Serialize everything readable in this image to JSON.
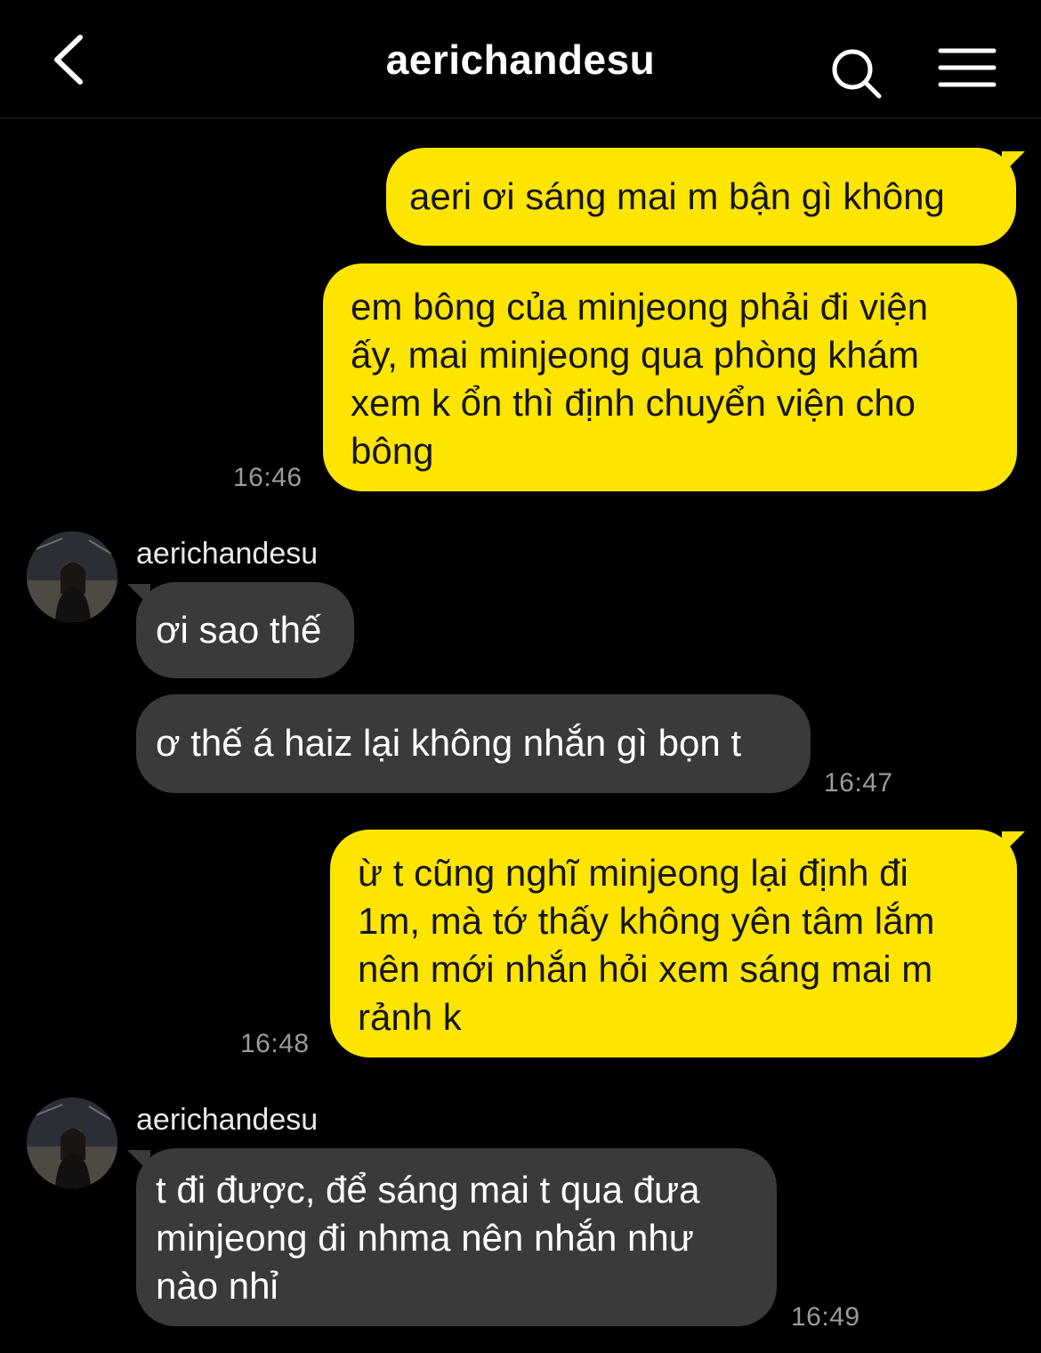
{
  "header": {
    "title": "aerichandesu",
    "back_icon": "chevron-left-icon",
    "search_icon": "search-icon",
    "menu_icon": "hamburger-menu-icon"
  },
  "colors": {
    "outgoing_bubble": "#FEE500",
    "incoming_bubble": "#3a3a3c",
    "background": "#000000",
    "timestamp": "#9a9a9a"
  },
  "messages": [
    {
      "direction": "out",
      "text": "aeri ơi sáng mai m bận gì không"
    },
    {
      "direction": "out",
      "lines": [
        "em bông của minjeong phải đi viện",
        "ấy, mai minjeong qua phòng khám",
        "xem k ổn thì định chuyển viện cho",
        "bông"
      ],
      "time": "16:46"
    },
    {
      "direction": "in",
      "sender": "aerichandesu",
      "text": "ơi sao thế"
    },
    {
      "direction": "in",
      "text": "ơ thế á haiz lại không nhắn gì bọn t",
      "time": "16:47"
    },
    {
      "direction": "out",
      "lines": [
        "ừ t cũng nghĩ minjeong lại định đi",
        "1m, mà tớ thấy không yên tâm lắm",
        "nên mới nhắn hỏi xem sáng mai m",
        "rảnh k"
      ],
      "time": "16:48"
    },
    {
      "direction": "in",
      "sender": "aerichandesu",
      "lines": [
        "t đi được, để sáng mai t qua đưa",
        "minjeong đi nhma nên nhắn như",
        "nào nhỉ"
      ],
      "time": "16:49"
    }
  ]
}
